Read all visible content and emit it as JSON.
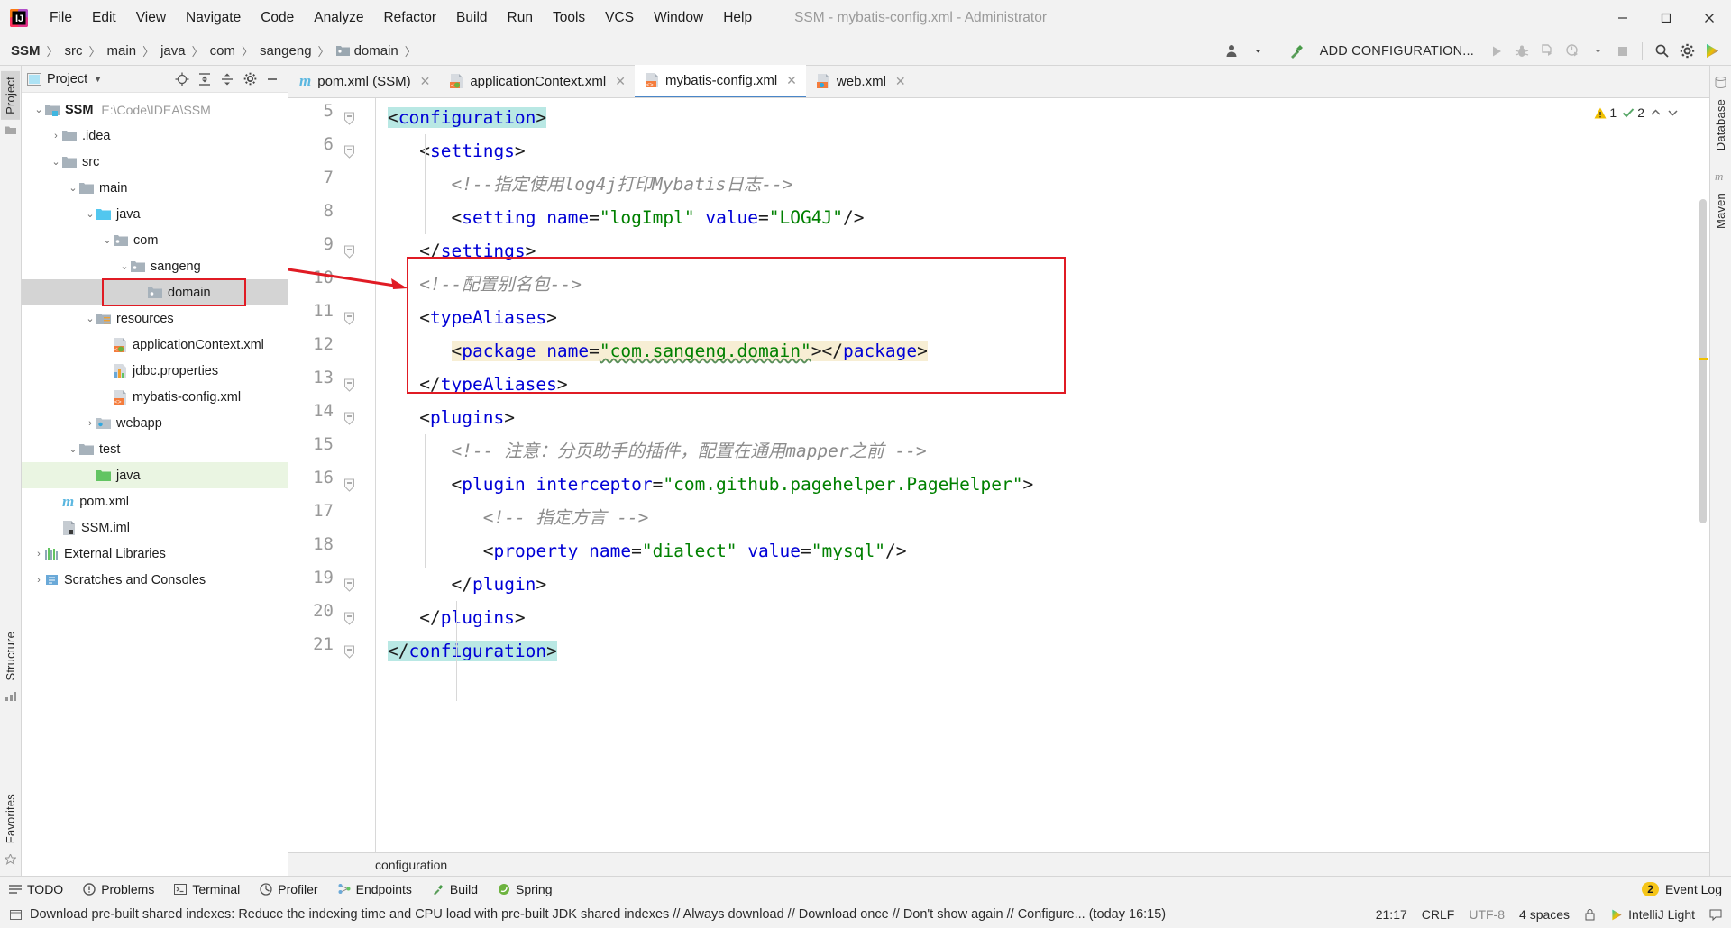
{
  "window": {
    "title": "SSM - mybatis-config.xml - Administrator",
    "minimize_label": "─",
    "maximize_label": "❐",
    "close_label": "✕"
  },
  "menubar": {
    "items": [
      {
        "label": "File",
        "mnemonic": "F"
      },
      {
        "label": "Edit",
        "mnemonic": "E"
      },
      {
        "label": "View",
        "mnemonic": "V"
      },
      {
        "label": "Navigate",
        "mnemonic": "N"
      },
      {
        "label": "Code",
        "mnemonic": "C"
      },
      {
        "label": "Analyze",
        "mnemonic": "z"
      },
      {
        "label": "Refactor",
        "mnemonic": "R"
      },
      {
        "label": "Build",
        "mnemonic": "B"
      },
      {
        "label": "Run",
        "mnemonic": "u"
      },
      {
        "label": "Tools",
        "mnemonic": "T"
      },
      {
        "label": "VCS",
        "mnemonic": "S"
      },
      {
        "label": "Window",
        "mnemonic": "W"
      },
      {
        "label": "Help",
        "mnemonic": "H"
      }
    ]
  },
  "breadcrumb": {
    "items": [
      "SSM",
      "src",
      "main",
      "java",
      "com",
      "sangeng",
      "domain"
    ],
    "separator": "〉"
  },
  "toolbar": {
    "add_configuration": "ADD CONFIGURATION...",
    "icons": [
      "user-avatar-icon",
      "chevron-down-icon",
      "hammer-build-icon",
      "run-icon",
      "debug-icon",
      "coverage-icon",
      "profile-icon",
      "chevron-down-icon",
      "stop-icon",
      "search-icon",
      "settings-gear-icon",
      "intellij-logo-icon"
    ]
  },
  "left_rail": {
    "tabs": [
      "Project",
      "Structure",
      "Favorites"
    ],
    "active": "Project"
  },
  "right_rail": {
    "tabs": [
      "Database",
      "Maven"
    ]
  },
  "project_panel": {
    "title": "Project",
    "header_icons": [
      "locate-icon",
      "expand-all-icon",
      "collapse-all-icon",
      "settings-gear-icon",
      "hide-icon"
    ],
    "tree": [
      {
        "label": "SSM",
        "sub": "E:\\Code\\IDEA\\SSM",
        "depth": 0,
        "arrow": "expanded",
        "icon": "module-folder-icon",
        "bold": true
      },
      {
        "label": ".idea",
        "sub": "",
        "depth": 1,
        "arrow": "collapsed",
        "icon": "folder-icon",
        "bold": false
      },
      {
        "label": "src",
        "sub": "",
        "depth": 1,
        "arrow": "expanded",
        "icon": "folder-icon",
        "bold": false
      },
      {
        "label": "main",
        "sub": "",
        "depth": 2,
        "arrow": "expanded",
        "icon": "folder-icon",
        "bold": false
      },
      {
        "label": "java",
        "sub": "",
        "depth": 3,
        "arrow": "expanded",
        "icon": "source-folder-icon",
        "bold": false
      },
      {
        "label": "com",
        "sub": "",
        "depth": 4,
        "arrow": "expanded",
        "icon": "package-icon",
        "bold": false
      },
      {
        "label": "sangeng",
        "sub": "",
        "depth": 5,
        "arrow": "expanded",
        "icon": "package-icon",
        "bold": false
      },
      {
        "label": "domain",
        "sub": "",
        "depth": 6,
        "arrow": "none",
        "icon": "package-icon",
        "bold": false,
        "selected": true,
        "highlighted": true
      },
      {
        "label": "resources",
        "sub": "",
        "depth": 3,
        "arrow": "expanded",
        "icon": "resources-folder-icon",
        "bold": false
      },
      {
        "label": "applicationContext.xml",
        "sub": "",
        "depth": 4,
        "arrow": "none",
        "icon": "spring-xml-icon",
        "bold": false
      },
      {
        "label": "jdbc.properties",
        "sub": "",
        "depth": 4,
        "arrow": "none",
        "icon": "properties-icon",
        "bold": false
      },
      {
        "label": "mybatis-config.xml",
        "sub": "",
        "depth": 4,
        "arrow": "none",
        "icon": "xml-icon",
        "bold": false
      },
      {
        "label": "webapp",
        "sub": "",
        "depth": 3,
        "arrow": "collapsed",
        "icon": "webapp-folder-icon",
        "bold": false
      },
      {
        "label": "test",
        "sub": "",
        "depth": 2,
        "arrow": "expanded",
        "icon": "folder-icon",
        "bold": false
      },
      {
        "label": "java",
        "sub": "",
        "depth": 3,
        "arrow": "none",
        "icon": "test-source-folder-icon",
        "bold": false,
        "greenbg": true
      },
      {
        "label": "pom.xml",
        "sub": "",
        "depth": 1,
        "arrow": "none",
        "icon": "maven-icon",
        "bold": false
      },
      {
        "label": "SSM.iml",
        "sub": "",
        "depth": 1,
        "arrow": "none",
        "icon": "iml-icon",
        "bold": false
      },
      {
        "label": "External Libraries",
        "sub": "",
        "depth": 0,
        "arrow": "collapsed",
        "icon": "libraries-icon",
        "bold": false
      },
      {
        "label": "Scratches and Consoles",
        "sub": "",
        "depth": 0,
        "arrow": "collapsed",
        "icon": "scratches-icon",
        "bold": false
      }
    ]
  },
  "editor": {
    "tabs": [
      {
        "label": "pom.xml (SSM)",
        "icon": "maven-icon",
        "active": false,
        "closable": true
      },
      {
        "label": "applicationContext.xml",
        "icon": "spring-xml-icon",
        "active": false,
        "closable": true
      },
      {
        "label": "mybatis-config.xml",
        "icon": "xml-icon",
        "active": true,
        "closable": true
      },
      {
        "label": "web.xml",
        "icon": "webxml-icon",
        "active": false,
        "closable": true
      }
    ],
    "inspection": {
      "warnings": "1",
      "checks": "2",
      "warn_icon": "warning-triangle-icon",
      "check_icon": "checkmark-icon"
    },
    "breadcrumb": "configuration",
    "first_line_number": 5,
    "lines": [
      {
        "num": 5,
        "indent": 0,
        "fold": "minus",
        "tokens": [
          {
            "t": "<",
            "c": "brk",
            "hl": "cyan"
          },
          {
            "t": "configuration",
            "c": "tagb",
            "hl": "cyan"
          },
          {
            "t": ">",
            "c": "brk",
            "hl": "cyan"
          }
        ]
      },
      {
        "num": 6,
        "indent": 1,
        "fold": "minus",
        "tokens": [
          {
            "t": "<",
            "c": "brk"
          },
          {
            "t": "settings",
            "c": "tagb"
          },
          {
            "t": ">",
            "c": "brk"
          }
        ]
      },
      {
        "num": 7,
        "indent": 2,
        "fold": "none",
        "tokens": [
          {
            "t": "<!--指定使用log4j打印Mybatis日志-->",
            "c": "cmt"
          }
        ]
      },
      {
        "num": 8,
        "indent": 2,
        "fold": "none",
        "tokens": [
          {
            "t": "<",
            "c": "brk"
          },
          {
            "t": "setting",
            "c": "tagb"
          },
          {
            "t": " ",
            "c": "brk"
          },
          {
            "t": "name",
            "c": "attr"
          },
          {
            "t": "=",
            "c": "brk"
          },
          {
            "t": "\"logImpl\"",
            "c": "val"
          },
          {
            "t": " ",
            "c": "brk"
          },
          {
            "t": "value",
            "c": "attr"
          },
          {
            "t": "=",
            "c": "brk"
          },
          {
            "t": "\"LOG4J\"",
            "c": "val"
          },
          {
            "t": "/>",
            "c": "brk"
          }
        ]
      },
      {
        "num": 9,
        "indent": 1,
        "fold": "minus",
        "tokens": [
          {
            "t": "</",
            "c": "brk"
          },
          {
            "t": "settings",
            "c": "tagb"
          },
          {
            "t": ">",
            "c": "brk"
          }
        ]
      },
      {
        "num": 10,
        "indent": 1,
        "fold": "none",
        "tokens": [
          {
            "t": "<!--配置别名包-->",
            "c": "cmt"
          }
        ]
      },
      {
        "num": 11,
        "indent": 1,
        "fold": "minus",
        "tokens": [
          {
            "t": "<",
            "c": "brk"
          },
          {
            "t": "typeAliases",
            "c": "tagb"
          },
          {
            "t": ">",
            "c": "brk"
          }
        ]
      },
      {
        "num": 12,
        "indent": 2,
        "fold": "none",
        "tokens": [
          {
            "t": "<",
            "c": "brk",
            "hl": "yellow"
          },
          {
            "t": "package",
            "c": "tagb",
            "hl": "yellow"
          },
          {
            "t": " ",
            "c": "brk",
            "hl": "yellow"
          },
          {
            "t": "name",
            "c": "attr",
            "hl": "yellow"
          },
          {
            "t": "=",
            "c": "brk",
            "hl": "yellow"
          },
          {
            "t": "\"com.sangeng.domain\"",
            "c": "val",
            "hl": "yellow",
            "wave": true
          },
          {
            "t": "></",
            "c": "brk",
            "hl": "yellow"
          },
          {
            "t": "package",
            "c": "tagb",
            "hl": "yellow"
          },
          {
            "t": ">",
            "c": "brk",
            "hl": "yellow"
          }
        ]
      },
      {
        "num": 13,
        "indent": 1,
        "fold": "minus",
        "tokens": [
          {
            "t": "</",
            "c": "brk"
          },
          {
            "t": "typeAliases",
            "c": "tagb"
          },
          {
            "t": ">",
            "c": "brk"
          }
        ]
      },
      {
        "num": 14,
        "indent": 1,
        "fold": "minus",
        "tokens": [
          {
            "t": "<",
            "c": "brk"
          },
          {
            "t": "plugins",
            "c": "tagb"
          },
          {
            "t": ">",
            "c": "brk"
          }
        ]
      },
      {
        "num": 15,
        "indent": 2,
        "fold": "none",
        "tokens": [
          {
            "t": "<!-- 注意：分页助手的插件，配置在通用mapper之前 -->",
            "c": "cmt"
          }
        ]
      },
      {
        "num": 16,
        "indent": 2,
        "fold": "minus",
        "tokens": [
          {
            "t": "<",
            "c": "brk"
          },
          {
            "t": "plugin",
            "c": "tagb"
          },
          {
            "t": " ",
            "c": "brk"
          },
          {
            "t": "interceptor",
            "c": "attr"
          },
          {
            "t": "=",
            "c": "brk"
          },
          {
            "t": "\"com.github.pagehelper.PageHelper\"",
            "c": "val"
          },
          {
            "t": ">",
            "c": "brk"
          }
        ]
      },
      {
        "num": 17,
        "indent": 3,
        "fold": "none",
        "tokens": [
          {
            "t": "<!-- 指定方言 -->",
            "c": "cmt"
          }
        ]
      },
      {
        "num": 18,
        "indent": 3,
        "fold": "none",
        "tokens": [
          {
            "t": "<",
            "c": "brk"
          },
          {
            "t": "property",
            "c": "tagb"
          },
          {
            "t": " ",
            "c": "brk"
          },
          {
            "t": "name",
            "c": "attr"
          },
          {
            "t": "=",
            "c": "brk"
          },
          {
            "t": "\"dialect\"",
            "c": "val"
          },
          {
            "t": " ",
            "c": "brk"
          },
          {
            "t": "value",
            "c": "attr"
          },
          {
            "t": "=",
            "c": "brk"
          },
          {
            "t": "\"mysql\"",
            "c": "val"
          },
          {
            "t": "/>",
            "c": "brk"
          }
        ]
      },
      {
        "num": 19,
        "indent": 2,
        "fold": "minus",
        "tokens": [
          {
            "t": "</",
            "c": "brk"
          },
          {
            "t": "plugin",
            "c": "tagb"
          },
          {
            "t": ">",
            "c": "brk"
          }
        ]
      },
      {
        "num": 20,
        "indent": 1,
        "fold": "minus",
        "tokens": [
          {
            "t": "</",
            "c": "brk"
          },
          {
            "t": "plugins",
            "c": "tagb"
          },
          {
            "t": ">",
            "c": "brk"
          }
        ]
      },
      {
        "num": 21,
        "indent": 0,
        "fold": "minus",
        "tokens": [
          {
            "t": "</",
            "c": "brk",
            "hl": "cyan"
          },
          {
            "t": "configuration",
            "c": "tagb",
            "hl": "cyan"
          },
          {
            "t": ">",
            "c": "brk",
            "hl": "cyan"
          }
        ]
      }
    ]
  },
  "toolwindow_bar": {
    "items": [
      {
        "label": "TODO",
        "icon": "todo-icon"
      },
      {
        "label": "Problems",
        "icon": "problems-icon"
      },
      {
        "label": "Terminal",
        "icon": "terminal-icon"
      },
      {
        "label": "Profiler",
        "icon": "profiler-icon"
      },
      {
        "label": "Endpoints",
        "icon": "endpoints-icon"
      },
      {
        "label": "Build",
        "icon": "build-hammer-icon"
      },
      {
        "label": "Spring",
        "icon": "spring-leaf-icon"
      }
    ],
    "event_log": {
      "label": "Event Log",
      "count": "2"
    }
  },
  "status_bar": {
    "message": "Download pre-built shared indexes: Reduce the indexing time and CPU load with pre-built JDK shared indexes // Always download // Download once // Don't show again // Configure... (today 16:15)",
    "time": "21:17",
    "line_separator": "CRLF",
    "encoding": "UTF-8",
    "indent": "4 spaces",
    "theme": "IntelliJ Light",
    "lock_icon": "lock-icon",
    "balloon_icon": "balloon-icon"
  },
  "colors": {
    "accent_blue": "#4a86c8",
    "highlight_red": "#e01b24",
    "selection_cyan": "#b9e8e4",
    "identifier_yellow": "#f7eed4",
    "green_bg": "#eaf5e2",
    "tag_blue": "#0000d6",
    "string_green": "#008000",
    "comment_gray": "#8c8c8c"
  }
}
